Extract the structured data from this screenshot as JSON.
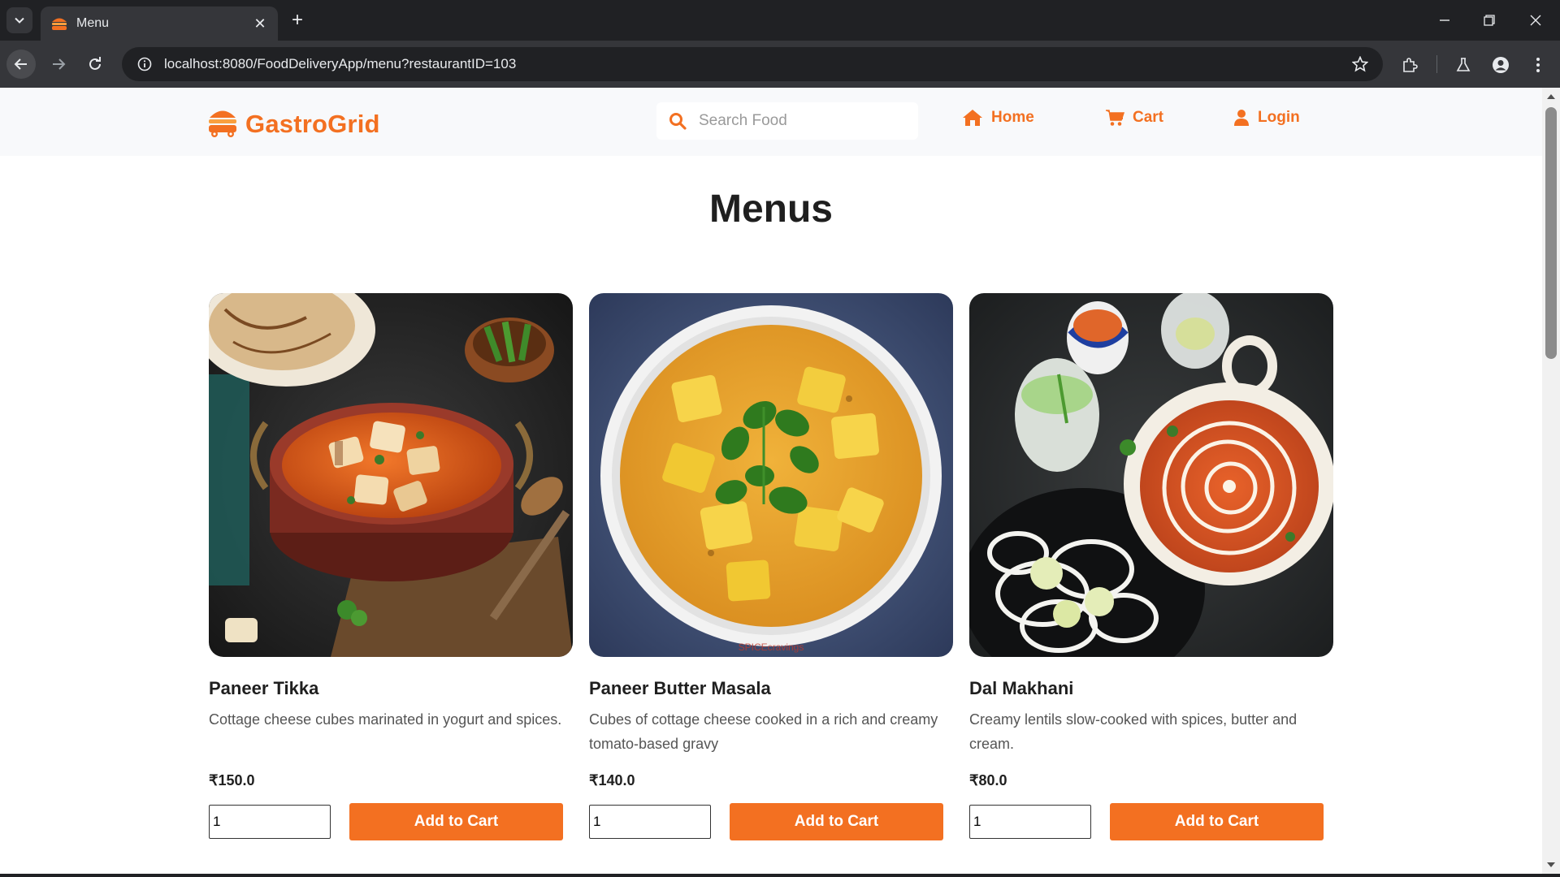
{
  "browser": {
    "tab_title": "Menu",
    "tab_close": "✕",
    "new_tab": "+",
    "url": "localhost:8080/FoodDeliveryApp/menu?restaurantID=103"
  },
  "header": {
    "brand": "GastroGrid",
    "search_placeholder": "Search Food",
    "nav": {
      "home": "Home",
      "cart": "Cart",
      "login": "Login"
    }
  },
  "main": {
    "title": "Menus",
    "items": [
      {
        "name": "Paneer Tikka",
        "description": "Cottage cheese cubes marinated in yogurt and spices.",
        "price": "₹150.0",
        "quantity": "1",
        "button": "Add to Cart"
      },
      {
        "name": "Paneer Butter Masala",
        "description": "Cubes of cottage cheese cooked in a rich and creamy tomato-based gravy",
        "price": "₹140.0",
        "quantity": "1",
        "button": "Add to Cart",
        "image_watermark": "SPICEcravings"
      },
      {
        "name": "Dal Makhani",
        "description": "Creamy lentils slow-cooked with spices, butter and cream.",
        "price": "₹80.0",
        "quantity": "1",
        "button": "Add to Cart"
      }
    ]
  },
  "colors": {
    "accent": "#f37021",
    "header_bg": "#f8f9fb",
    "text_dark": "#1f1f1f",
    "text_muted": "#555555"
  },
  "icons": [
    "tab-list-icon",
    "burger-logo-icon",
    "close-icon",
    "plus-icon",
    "minimize-icon",
    "restore-icon",
    "back-arrow-icon",
    "forward-arrow-icon",
    "reload-icon",
    "site-info-icon",
    "star-icon",
    "extensions-icon",
    "labs-flask-icon",
    "profile-icon",
    "more-menu-icon",
    "search-icon",
    "home-icon",
    "cart-icon",
    "user-icon"
  ]
}
